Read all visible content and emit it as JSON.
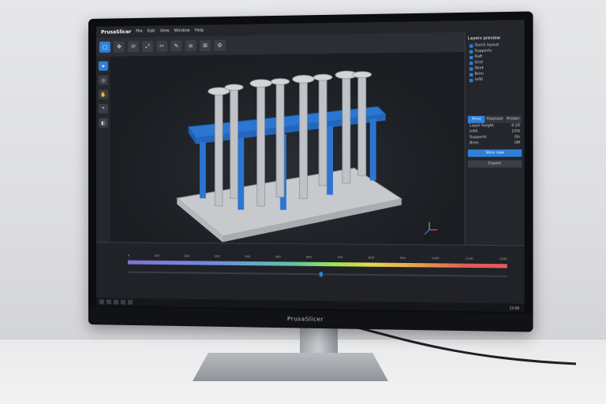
{
  "app": {
    "name": "PrusaSlicer",
    "menu": [
      "File",
      "Edit",
      "View",
      "Window",
      "Help"
    ]
  },
  "monitor": {
    "brand": "PrusaSlicer"
  },
  "right_panel": {
    "title": "Layers preview",
    "objects": [
      "Quick layout",
      "Supports",
      "Raft",
      "Grid",
      "Skirt",
      "Brim",
      "Infill"
    ],
    "tabs": [
      "Print",
      "Filament",
      "Printer"
    ],
    "rows": [
      {
        "label": "Layer height",
        "value": "0.20"
      },
      {
        "label": "Infill",
        "value": "15%"
      },
      {
        "label": "Supports",
        "value": "On"
      },
      {
        "label": "Brim",
        "value": "Off"
      }
    ],
    "primary_button": "Slice now",
    "secondary_button": "Export"
  },
  "timeline": {
    "ticks": [
      "0",
      "100",
      "200",
      "300",
      "400",
      "500",
      "600",
      "700",
      "800",
      "900",
      "1000",
      "1100",
      "1200"
    ],
    "handle_fraction": 0.52
  },
  "taskbar": {
    "clock": "12:00"
  },
  "colors": {
    "accent": "#2f7fd8",
    "support_blue": "#2a76d2",
    "model_grey": "#bfc2c7"
  }
}
